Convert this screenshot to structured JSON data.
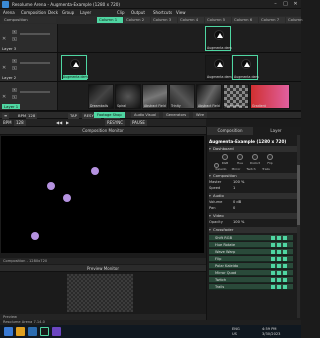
{
  "window": {
    "title": "Resolume Arena - Augmenta-Example (1280 x 720)",
    "min": "–",
    "max": "□",
    "close": "✕"
  },
  "menu": [
    "Arena",
    "Composition",
    "Deck",
    "Group",
    "Layer",
    "Clip",
    "Output",
    "Shortcuts",
    "View"
  ],
  "composition_label": "Composition",
  "columns": [
    "Column 1",
    "Column 2",
    "Column 3",
    "Column 4",
    "Column 5",
    "Column 6",
    "Column 7",
    "Column 8"
  ],
  "layers": [
    {
      "name": "Layer 3",
      "clips": [
        "",
        "",
        "",
        "",
        "Augmenta dem",
        "",
        "",
        ""
      ]
    },
    {
      "name": "Layer 2",
      "clips": [
        "Augmenta dem",
        "",
        "",
        "",
        "Augmenta dem",
        "Augmenta dem",
        "",
        ""
      ]
    },
    {
      "name": "Layer 1",
      "clips": [
        "",
        "Dreamballs",
        "Spiral",
        "Abstract Field",
        "Trinity",
        "Abstract Field",
        "Checkered",
        "Gradient"
      ]
    }
  ],
  "layer_buttons": {
    "bypass": "B",
    "solo": "S"
  },
  "toolbar": {
    "bpm_label": "BPM",
    "bpm_value": "128",
    "resync": "RESYNC",
    "pause": "PAUSE",
    "tap": "TAP"
  },
  "tabs": [
    "Footage Shop",
    "Audio Visual",
    "Generators",
    "Wire"
  ],
  "transport": {
    "play": "▶",
    "back": "◀◀"
  },
  "composition_monitor": {
    "title": "Composition Monitor",
    "size_label": "Composition - 1280x720"
  },
  "preview_monitor": {
    "title": "Preview Monitor",
    "footer": "Preview"
  },
  "right_panel": {
    "tabs": [
      "Composition",
      "Layer"
    ],
    "comp_name": "Augmenta-Example (1280 x 720)",
    "dashboard": "Dashboard",
    "knobs": [
      "RGB",
      "Hue",
      "Distort",
      "Flip",
      "Kaleido",
      "Mirror",
      "Twitch",
      "Trails"
    ],
    "composition_section": "Composition",
    "master": {
      "label": "Master",
      "value": "100 %"
    },
    "speed": {
      "label": "Speed",
      "value": "1"
    },
    "audio_section": "Audio",
    "volume": {
      "label": "Volume",
      "value": "0 dB"
    },
    "pan": {
      "label": "Pan",
      "value": "0"
    },
    "video_section": "Video",
    "opacity": {
      "label": "Opacity",
      "value": "100 %"
    },
    "crossfader": "Crossfader",
    "effects": [
      "Shift RGB",
      "Hue Rotate",
      "Wave Warp",
      "Flip",
      "Polar Kaleido",
      "Mirror Quad",
      "Twitch",
      "Trails"
    ]
  },
  "status_bar": "Resolume Arena 7.14.0",
  "taskbar": {
    "lang": "ENG",
    "region": "US",
    "time": "4:59 PM",
    "date": "3/30/2023"
  },
  "colors": {
    "accent": "#4fd6a2",
    "dot": "#b592e0"
  }
}
